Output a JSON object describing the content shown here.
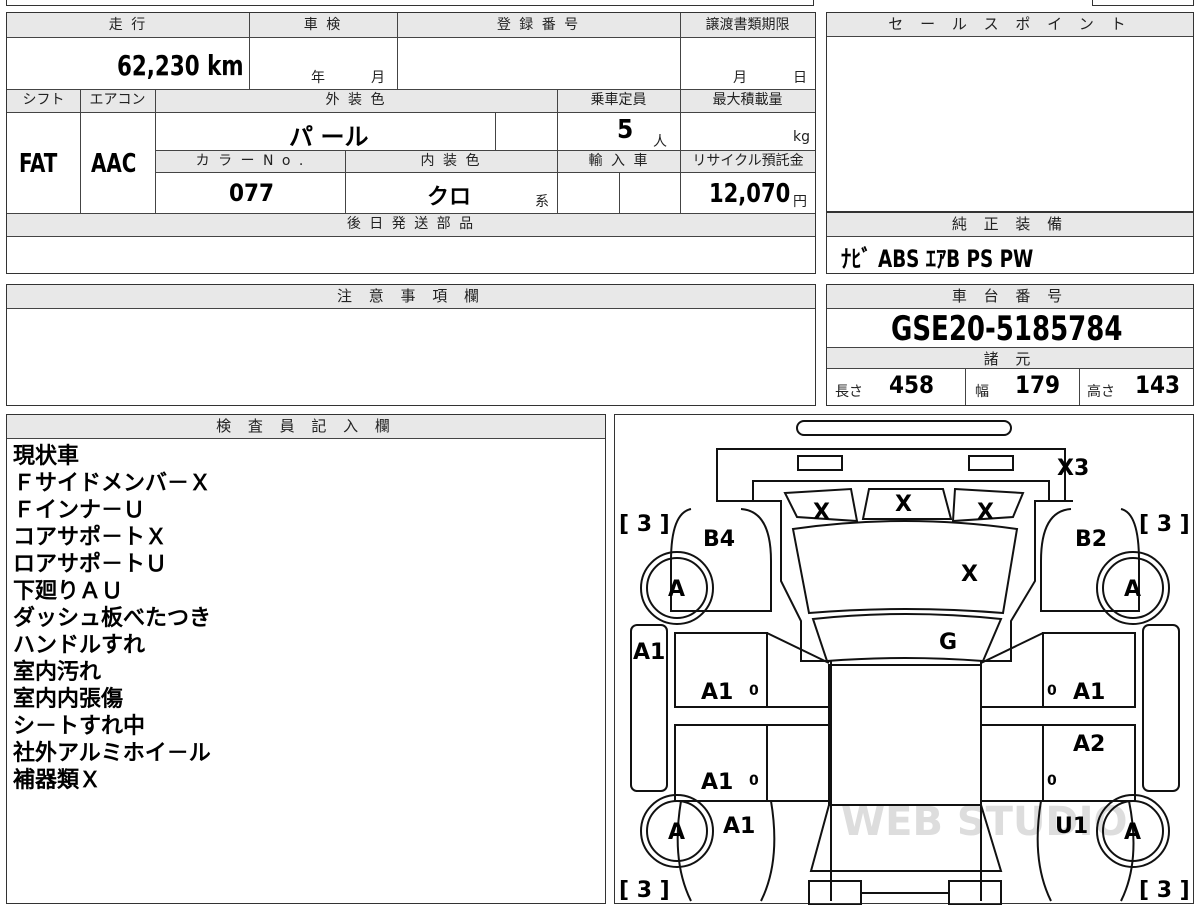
{
  "vehicle": {
    "mileage_label": "走 行",
    "mileage": "62,230 km",
    "inspection_label": "車 検",
    "inspection_year_unit": "年",
    "inspection_month_unit": "月",
    "registration_label": "登 録 番 号",
    "transfer_deadline_label": "譲渡書類期限",
    "transfer_month_unit": "月",
    "transfer_day_unit": "日",
    "shift_label": "シフト",
    "shift": "FAT",
    "aircon_label": "エアコン",
    "aircon": "AAC",
    "exterior_color_label": "外 装 色",
    "exterior_color": "パ ール",
    "capacity_label": "乗車定員",
    "capacity": "5",
    "capacity_unit": "人",
    "max_load_label": "最大積載量",
    "max_load_unit": "kg",
    "color_no_label": "カ ラ ー N o .",
    "color_no": "077",
    "interior_color_label": "内 装 色",
    "interior_color": "クロ",
    "interior_color_suffix": "系",
    "import_label": "輸 入 車",
    "recycle_label": "リサイクル預託金",
    "recycle_fee": "12,070",
    "recycle_unit": "円",
    "later_parts_label": "後 日 発 送 部 品",
    "notes_label": "注 意 事 項 欄"
  },
  "sales_point": {
    "label": "セ ー ル ス ポ イ ン ト"
  },
  "equipment": {
    "label": "純 正 装 備",
    "items": "ﾅﾋﾞ  ABS  ｴｱB  PS  PW"
  },
  "chassis": {
    "label": "車 台 番 号",
    "number": "GSE20-5185784",
    "specs_label": "諸 元",
    "length_label": "長さ",
    "length": "458",
    "width_label": "幅",
    "width": "179",
    "height_label": "高さ",
    "height": "143"
  },
  "inspector": {
    "label": "検 査 員 記 入 欄",
    "notes": [
      "現状車",
      "Ｆサイドメンバ－Ｘ",
      "Ｆインナ－Ｕ",
      "コアサポ－トＸ",
      "ロアサポ－トＵ",
      "下廻りＡＵ",
      "ダッシュ板べたつき",
      "ハンドルすれ",
      "室内汚れ",
      "室内内張傷",
      "シ－トすれ中",
      "社外アルミホイ－ル",
      "補器類Ｘ"
    ]
  },
  "diagram": {
    "watermark": "WEB STUDIO",
    "marks": {
      "front_bumper": "X3",
      "grille_left": "X",
      "grille_center": "X",
      "grille_right": "X",
      "hood": "X",
      "windshield": "G",
      "fender_left": "B4",
      "fender_right": "B2",
      "tire_count_fl": "[ 3 ]",
      "tire_count_fr": "[ 3 ]",
      "tire_count_rl": "[ 3 ]",
      "tire_count_rr": "[ 3 ]",
      "wheel_fl": "A",
      "wheel_fr": "A",
      "wheel_rl": "A",
      "wheel_rr": "A",
      "side_left": "A1",
      "door_fl": "A1",
      "door_fl_mark": "0",
      "door_rl": "A1",
      "door_rl_mark": "0",
      "rear_fender_left": "A1",
      "door_fr": "A1",
      "door_fr_mark": "0",
      "door_rr": "A2",
      "door_rr_mark": "0",
      "rear_fender_right": "U1"
    }
  }
}
